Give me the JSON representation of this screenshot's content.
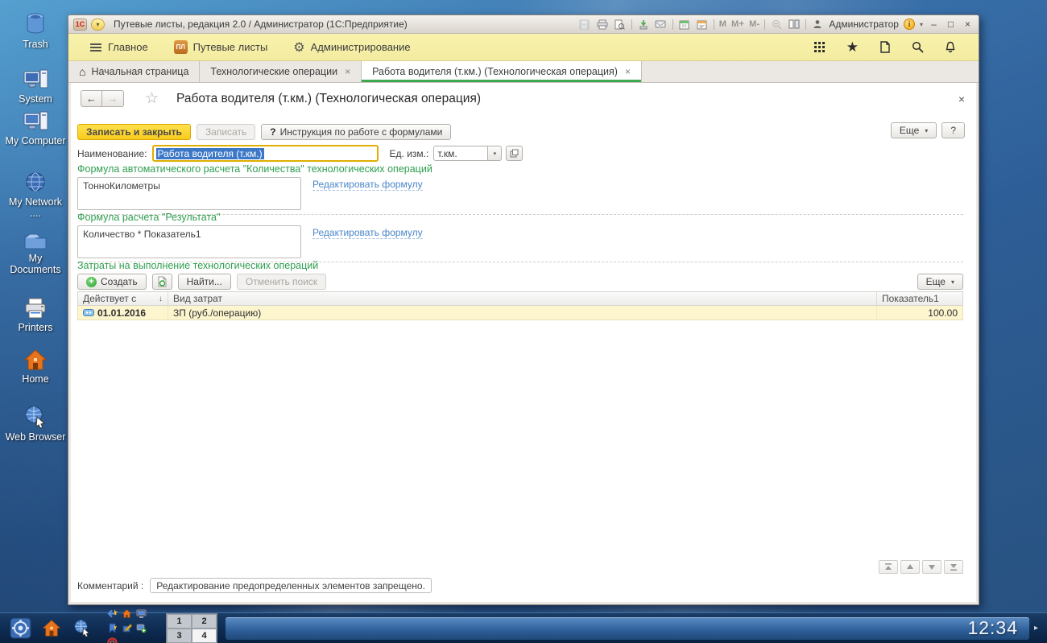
{
  "desktop": {
    "icons": [
      {
        "name": "trash",
        "label": "Trash"
      },
      {
        "name": "system",
        "label": "System"
      },
      {
        "name": "my-computer",
        "label": "My Computer"
      },
      {
        "name": "my-network",
        "label": "My Network ...."
      },
      {
        "name": "my-documents",
        "label": "My Documents"
      },
      {
        "name": "printers",
        "label": "Printers"
      },
      {
        "name": "home",
        "label": "Home"
      },
      {
        "name": "web-browser",
        "label": "Web Browser"
      }
    ]
  },
  "window": {
    "title": "Путевые листы, редакция 2.0 / Администратор  (1С:Предприятие)",
    "logo": "1С",
    "user_label": "Администратор",
    "calc_buttons": [
      "M",
      "M+",
      "M-"
    ]
  },
  "menubar": {
    "items": [
      {
        "label": "Главное"
      },
      {
        "label": "Путевые листы",
        "badge": "ПЛ"
      },
      {
        "label": "Администрирование"
      }
    ]
  },
  "tabs": [
    {
      "label": "Начальная страница"
    },
    {
      "label": "Технологические операции"
    },
    {
      "label": "Работа водителя (т.км.) (Технологическая операция)"
    }
  ],
  "form": {
    "title": "Работа водителя (т.км.) (Технологическая операция)",
    "buttons": {
      "save_close": "Записать и закрыть",
      "save": "Записать",
      "instruction": "Инструкция по работе с формулами",
      "more": "Еще",
      "help": "?"
    },
    "fields": {
      "name_label": "Наименование:",
      "name_value": "Работа водителя (т.км.)",
      "unit_label": "Ед. изм.:",
      "unit_value": "т.км."
    },
    "sections": [
      {
        "title": "Формула автоматического расчета \"Количества\" технологических операций",
        "formula": "ТонноКилометры",
        "link": "Редактировать формулу"
      },
      {
        "title": "Формула расчета \"Результата\"",
        "formula": "Количество * Показатель1",
        "link": "Редактировать формулу"
      }
    ],
    "costs": {
      "title": "Затраты на выполнение технологических операций",
      "toolbar": {
        "create": "Создать",
        "find": "Найти...",
        "cancel_search": "Отменить поиск",
        "more": "Еще"
      },
      "table": {
        "columns": [
          "Действует с",
          "Вид затрат",
          "Показатель1"
        ],
        "rows": [
          {
            "date": "01.01.2016",
            "type": "ЗП (руб./операцию)",
            "value": "100.00"
          }
        ]
      }
    },
    "comment_label": "Комментарий :",
    "comment_value": "Редактирование предопределенных элементов запрещено."
  },
  "taskbar": {
    "pager": [
      "1",
      "2",
      "3",
      "4"
    ],
    "active_desktop": "4",
    "clock": "12:34"
  },
  "glyphs": {
    "back": "←",
    "forward": "→",
    "star": "★",
    "star_outline": "☆",
    "gear": "⚙",
    "home_tab": "⌂",
    "close": "×",
    "minimize": "–",
    "maximize": "□",
    "dropdown": "▾",
    "sort_down": "↓",
    "question": "?",
    "plus": "+",
    "arrow_right": "▸",
    "info": "i",
    "refresh": "↻"
  },
  "colors": {
    "accent_green": "#2E9E4F",
    "link_blue": "#4A86C8",
    "primary_yellow": "#F8CB1C",
    "selection_blue": "#3C77C8",
    "row_yellow": "#FCF5CE",
    "menubar_yellow": "#F6F0A8"
  }
}
